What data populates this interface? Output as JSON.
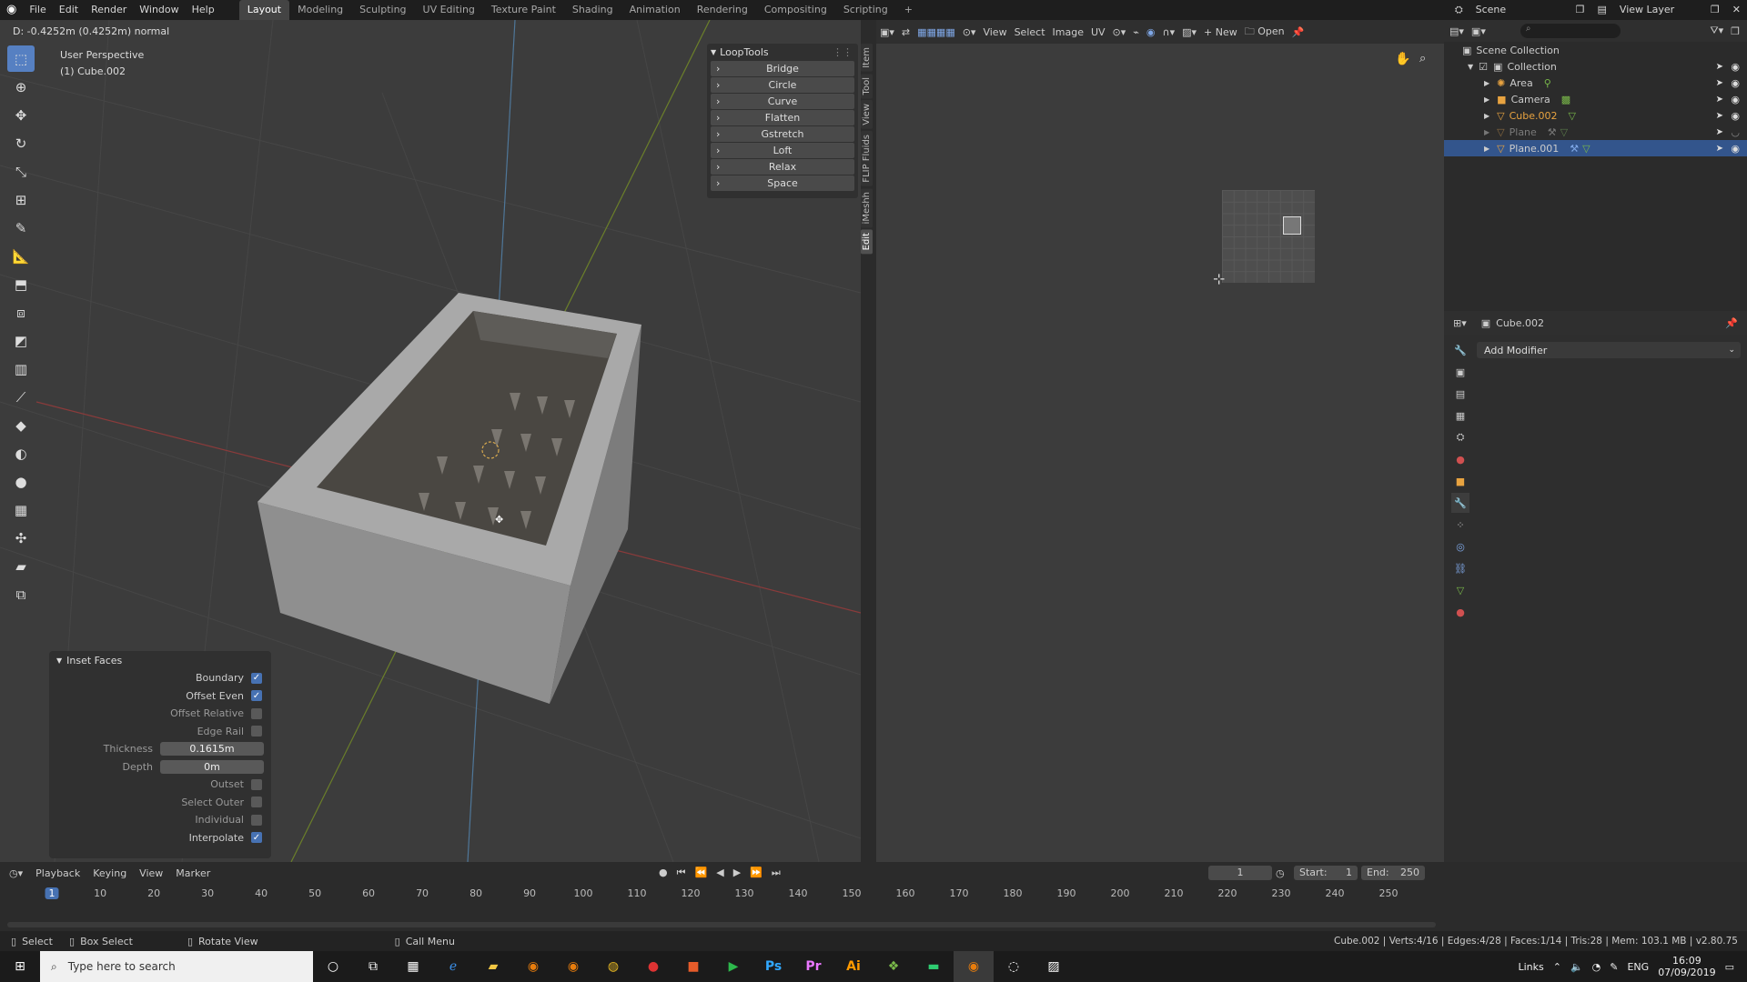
{
  "topbar": {
    "menus": [
      "File",
      "Edit",
      "Render",
      "Window",
      "Help"
    ],
    "workspaces": [
      "Layout",
      "Modeling",
      "Sculpting",
      "UV Editing",
      "Texture Paint",
      "Shading",
      "Animation",
      "Rendering",
      "Compositing",
      "Scripting"
    ],
    "active_workspace": "Layout",
    "add_tab": "+",
    "scene_label": "Scene",
    "view_layer_label": "View Layer"
  },
  "viewport": {
    "header_info": "D: -0.4252m (0.4252m) normal",
    "overlay_title": "User Perspective",
    "overlay_object": "(1) Cube.002"
  },
  "looptools": {
    "title": "LoopTools",
    "items": [
      "Bridge",
      "Circle",
      "Curve",
      "Flatten",
      "Gstretch",
      "Loft",
      "Relax",
      "Space"
    ]
  },
  "side_tabs": [
    "Item",
    "Tool",
    "View",
    "FLIP Fluids",
    "iMeshh",
    "Edit"
  ],
  "inset_faces": {
    "title": "Inset Faces",
    "boundary_label": "Boundary",
    "boundary": true,
    "offset_even_label": "Offset Even",
    "offset_even": true,
    "offset_relative_label": "Offset Relative",
    "offset_relative": false,
    "edge_rail_label": "Edge Rail",
    "edge_rail": false,
    "thickness_label": "Thickness",
    "thickness": "0.1615m",
    "depth_label": "Depth",
    "depth": "0m",
    "outset_label": "Outset",
    "outset": false,
    "select_outer_label": "Select Outer",
    "select_outer": false,
    "individual_label": "Individual",
    "individual": false,
    "interpolate_label": "Interpolate",
    "interpolate": true
  },
  "uv_header": {
    "view": "View",
    "select": "Select",
    "image": "Image",
    "uv": "UV",
    "new_label": "New",
    "open_label": "Open"
  },
  "outliner": {
    "scene_collection": "Scene Collection",
    "collection": "Collection",
    "objects": [
      {
        "name": "Area",
        "color": "#dcdcdc"
      },
      {
        "name": "Camera",
        "color": "#dcdcdc"
      },
      {
        "name": "Cube.002",
        "color": "#e8a340"
      },
      {
        "name": "Plane",
        "color": "#7a7a7a"
      },
      {
        "name": "Plane.001",
        "color": "#dcdcdc"
      }
    ]
  },
  "properties": {
    "object_name": "Cube.002",
    "add_modifier": "Add Modifier"
  },
  "timeline": {
    "playback": "Playback",
    "keying": "Keying",
    "view": "View",
    "marker": "Marker",
    "current_frame": "1",
    "start_label": "Start:",
    "start": "1",
    "end_label": "End:",
    "end": "250",
    "ruler": [
      "1",
      "10",
      "20",
      "30",
      "40",
      "50",
      "60",
      "70",
      "80",
      "90",
      "100",
      "110",
      "120",
      "130",
      "140",
      "150",
      "160",
      "170",
      "180",
      "190",
      "200",
      "210",
      "220",
      "230",
      "240",
      "250"
    ]
  },
  "statusbar": {
    "select": "Select",
    "box_select": "Box Select",
    "rotate_view": "Rotate View",
    "call_menu": "Call Menu",
    "stats": "Cube.002 | Verts:4/16 | Edges:4/28 | Faces:1/14 | Tris:28 | Mem: 103.1 MB | v2.80.75"
  },
  "taskbar": {
    "search_placeholder": "Type here to search",
    "tray_links": "Links",
    "lang": "ENG",
    "time": "16:09",
    "date": "07/09/2019"
  }
}
